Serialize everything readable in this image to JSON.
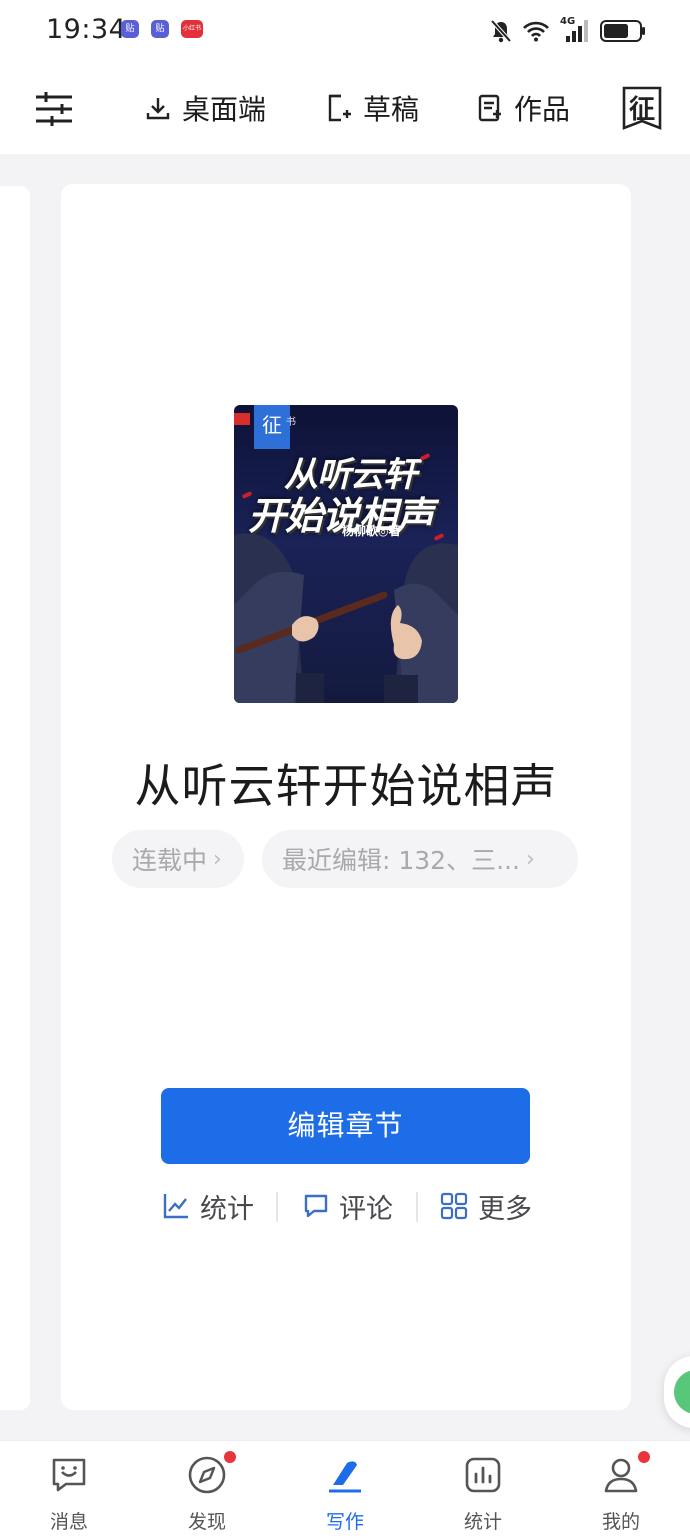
{
  "status_bar": {
    "time": "19:34",
    "badges": [
      "贴",
      "贴",
      "小红书"
    ],
    "network": "4G",
    "icons": [
      "mute-icon",
      "wifi-icon",
      "signal-icon",
      "battery-icon"
    ]
  },
  "toolbar": {
    "settings_icon": "sliders-icon",
    "desktop_label": "桌面端",
    "draft_label": "草稿",
    "works_label": "作品",
    "badge_label": "征"
  },
  "book": {
    "title": "从听云轩开始说相声",
    "cover": {
      "ribbon": "征",
      "corner": "书",
      "line1": "从听云轩",
      "line2": "开始说相声",
      "author": "杨柳歌◎著"
    },
    "status_chip": "连载中",
    "recent_chip": "最近编辑: 132、三..."
  },
  "actions": {
    "primary": "编辑章节",
    "stats": "统计",
    "comments": "评论",
    "more": "更多"
  },
  "bottom_nav": [
    {
      "label": "消息",
      "icon": "message-smile-icon"
    },
    {
      "label": "发现",
      "icon": "compass-icon"
    },
    {
      "label": "写作",
      "icon": "pen-icon"
    },
    {
      "label": "统计",
      "icon": "bar-chart-icon"
    },
    {
      "label": "我的",
      "icon": "person-icon"
    }
  ],
  "colors": {
    "accent": "#1d6ce8",
    "notification": "#e8353b",
    "background": "#f3f3f5"
  }
}
